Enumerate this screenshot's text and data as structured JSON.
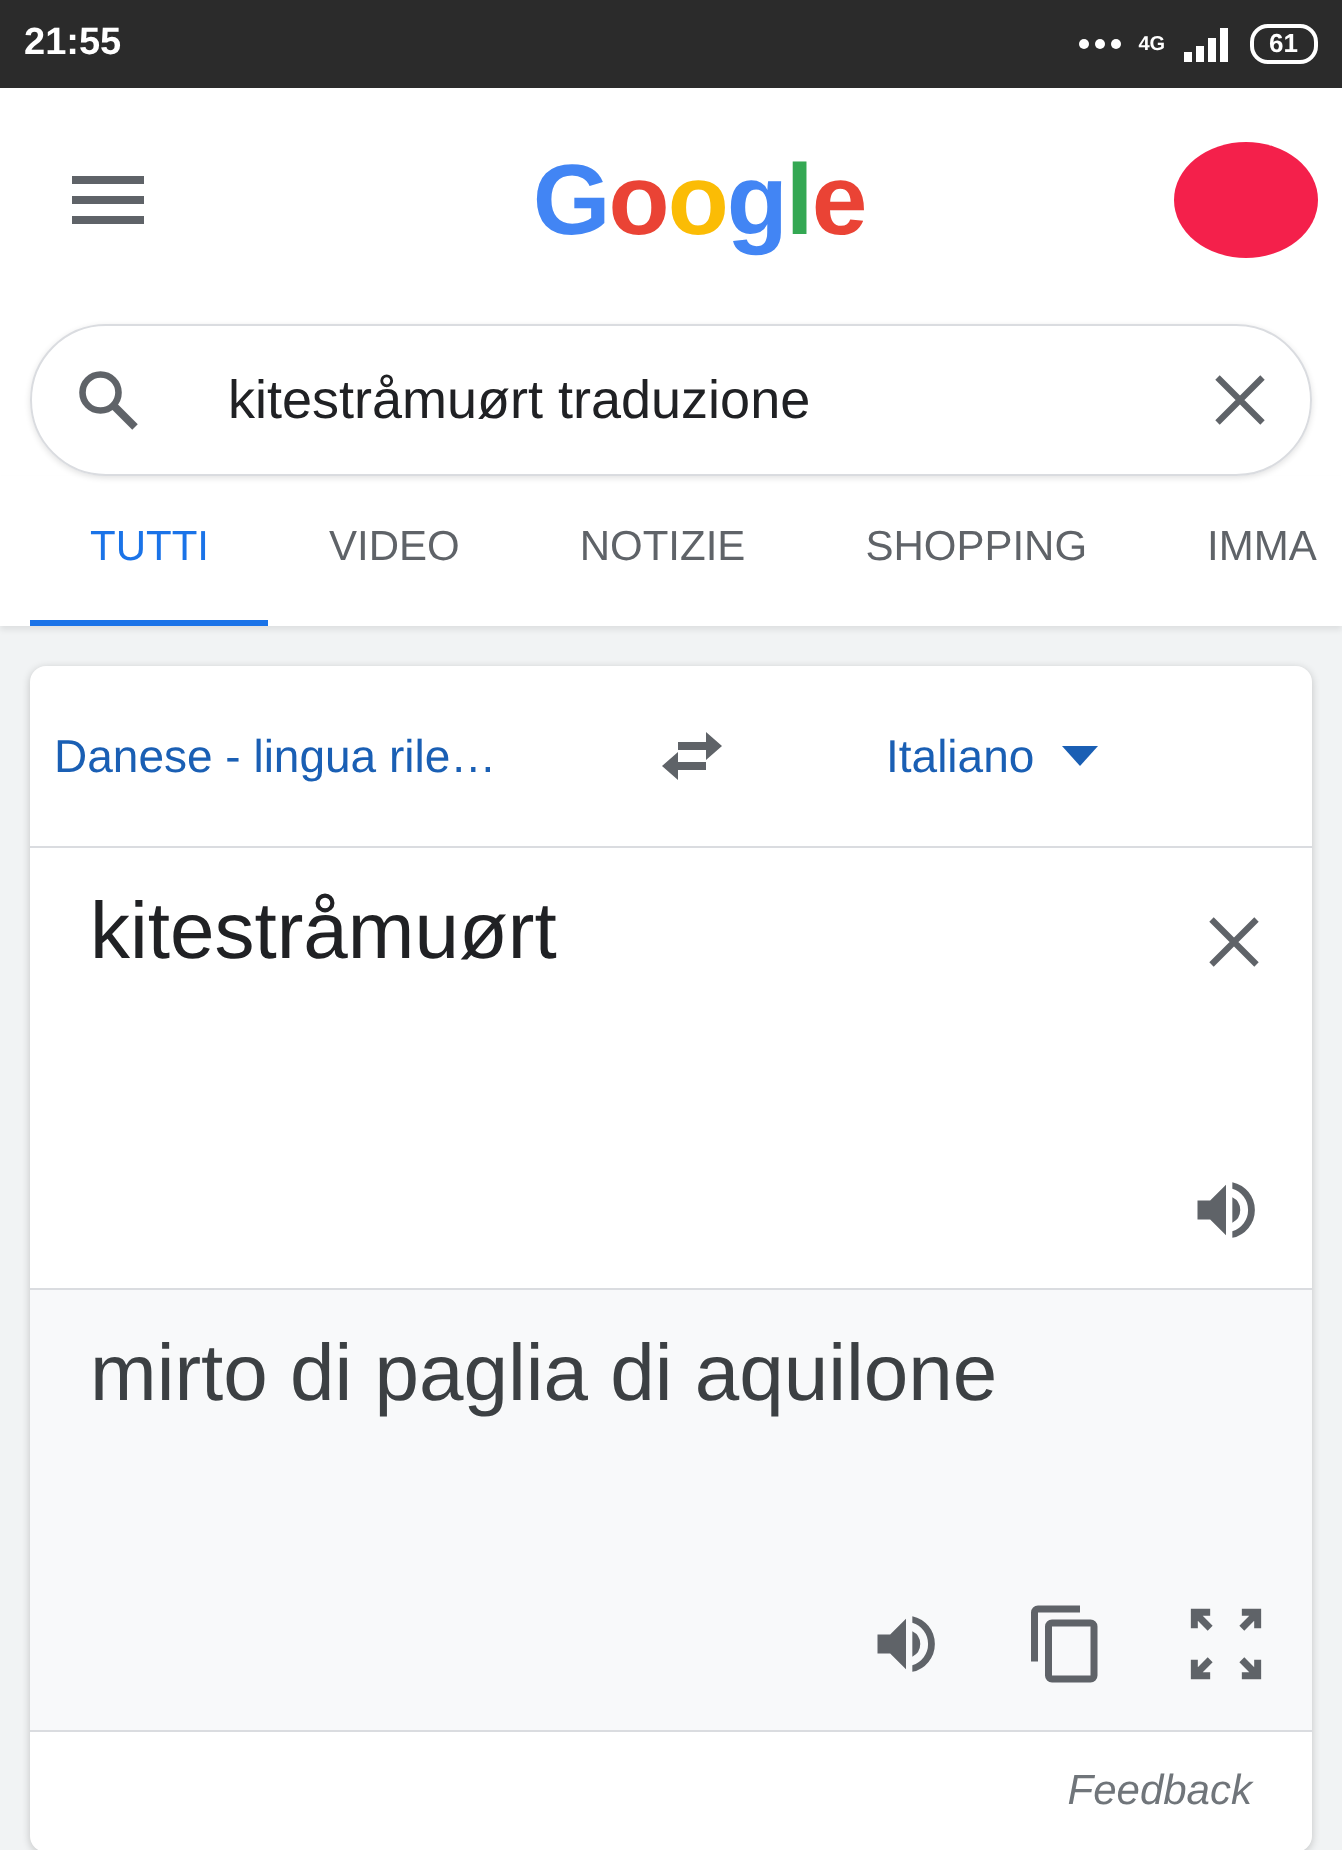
{
  "status_bar": {
    "time": "21:55",
    "network": "4G",
    "battery": "61"
  },
  "header": {
    "logo": "Google"
  },
  "search": {
    "value": "kitestråmuørt traduzione"
  },
  "tabs": [
    {
      "label": "TUTTI",
      "selected": true
    },
    {
      "label": "VIDEO",
      "selected": false
    },
    {
      "label": "NOTIZIE",
      "selected": false
    },
    {
      "label": "SHOPPING",
      "selected": false
    },
    {
      "label": "IMMA",
      "selected": false
    }
  ],
  "translator": {
    "source_language": "Danese - lingua rile…",
    "target_language": "Italiano",
    "source_text": "kitestråmuørt",
    "translation": "mirto di paglia di aquilone",
    "feedback": "Feedback"
  }
}
